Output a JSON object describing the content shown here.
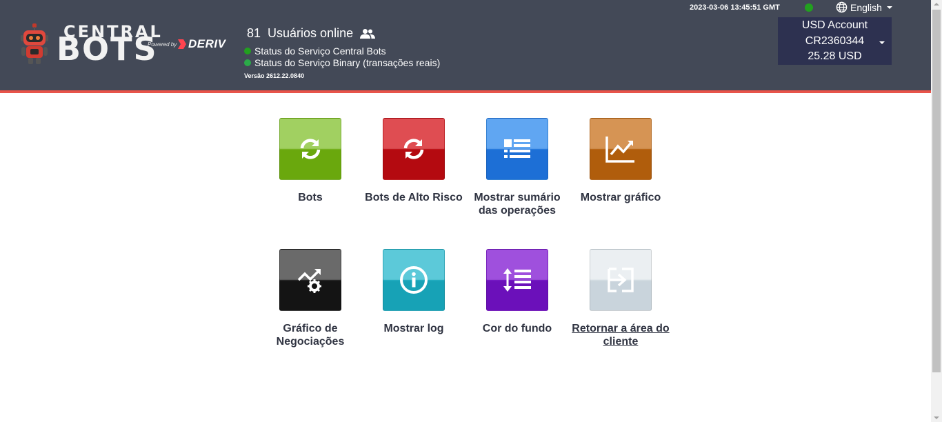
{
  "brand": {
    "logo_top": "CENTRAL",
    "logo_bottom": "BOTS",
    "powered_by": "Powered by",
    "partner": "DERIV"
  },
  "header": {
    "online_count": "81",
    "online_label": "Usuários online",
    "status_central": "Status do Serviço Central Bots",
    "status_binary": "Status do Serviço Binary (transações reais)",
    "version": "Versão 2612.22.0840",
    "clock": "2023-03-06 13:45:51 GMT",
    "language": "English",
    "account": {
      "type": "USD Account",
      "id": "CR2360344",
      "balance": "25.28 USD"
    }
  },
  "tiles": [
    {
      "label": "Bots",
      "icon": "refresh-icon",
      "color": "#8dc63f"
    },
    {
      "label": "Bots de Alto Risco",
      "icon": "refresh-icon",
      "color": "#d8272c"
    },
    {
      "label": "Mostrar sumário das operações",
      "icon": "list-icon",
      "color": "#3d93f0"
    },
    {
      "label": "Mostrar gráfico",
      "icon": "line-chart-icon",
      "color": "#cd7d2f"
    },
    {
      "label": "Gráfico de Negociações",
      "icon": "chart-settings-icon",
      "color": "#141414"
    },
    {
      "label": "Mostrar log",
      "icon": "info-icon",
      "color": "#17a2b6"
    },
    {
      "label": "Cor do fundo",
      "icon": "line-height-icon",
      "color": "#6b10ba"
    },
    {
      "label": "Retornar a área do cliente",
      "icon": "sign-in-icon",
      "color": "#dfe6eb"
    }
  ]
}
